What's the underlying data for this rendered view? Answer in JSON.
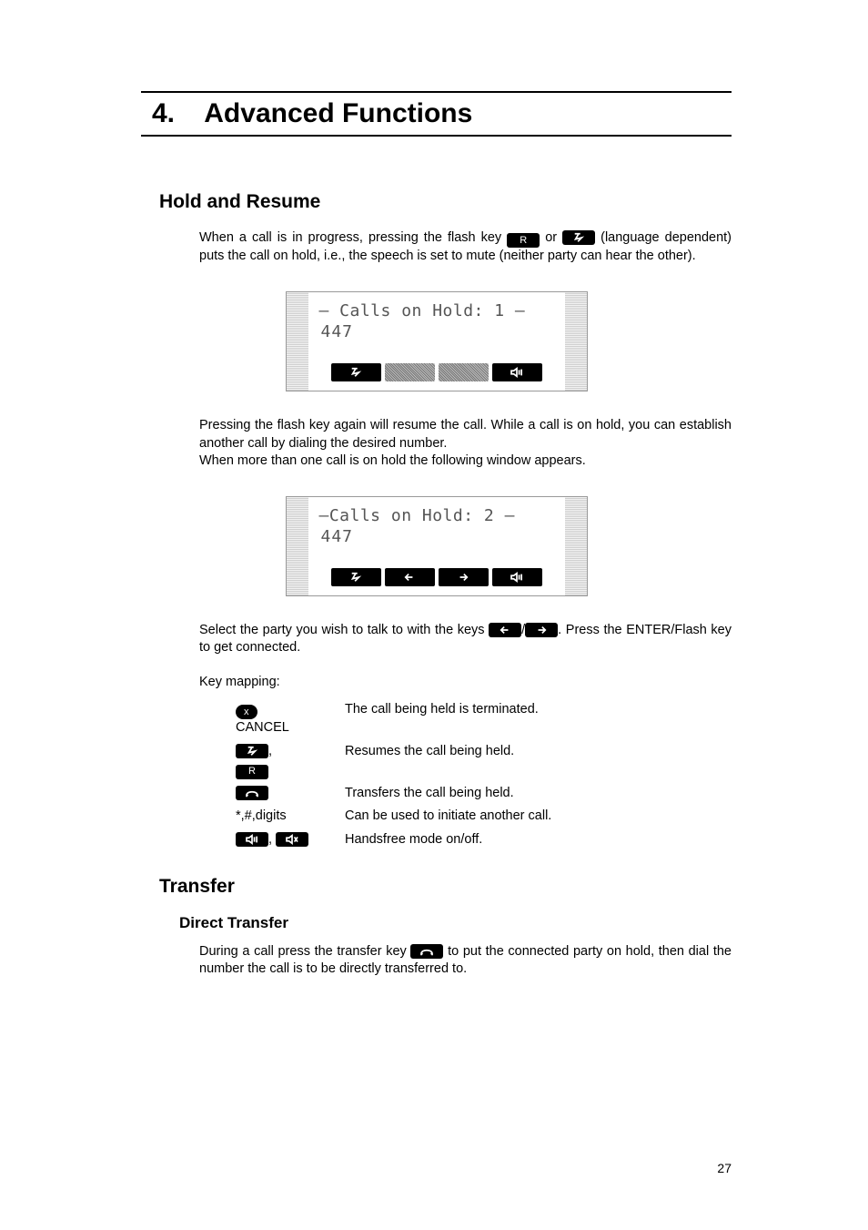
{
  "chapter": {
    "number": "4.",
    "title": "Advanced Functions"
  },
  "section_hold": {
    "heading": "Hold and Resume",
    "p1a": "When a call is in progress, pressing the flash key ",
    "p1_or": " or ",
    "p1b": " (language dependent) puts the call on hold, i.e., the speech is set to mute (neither party can hear the other).",
    "p2": "Pressing the flash key again will resume the call. While a call is on hold, you can establish another call by dialing the desired number.",
    "p3": "When more than one call is on hold the following window appears.",
    "p4a": "Select the party you wish to talk to with the keys ",
    "p4b": ".  Press the ENTER/Flash key to get connected.",
    "keymap_label": "Key mapping:"
  },
  "screens": {
    "one": {
      "title": "— Calls on Hold: 1 —",
      "number": "447"
    },
    "two": {
      "title": "—Calls on Hold: 2 —",
      "number": "447"
    }
  },
  "keymap": {
    "cancel_label": "CANCEL",
    "cancel_desc": "The call being held is terminated.",
    "resume_desc": "Resumes the call being held.",
    "transfer_desc": "Transfers the call being held.",
    "digits_label": "*,#,digits",
    "digits_desc": "Can be used to initiate another call.",
    "handsfree_desc": "Handsfree mode on/off."
  },
  "section_transfer": {
    "heading": "Transfer",
    "sub": "Direct Transfer",
    "p1a": "During a call press the transfer key ",
    "p1b": " to put the connected party on hold, then dial the number the call is to be directly transferred to."
  },
  "keys": {
    "R": "R",
    "flash_glyph": "↯",
    "arrow_left": "←",
    "arrow_right": "→",
    "separator": "/",
    "comma": ", "
  },
  "page_number": "27"
}
